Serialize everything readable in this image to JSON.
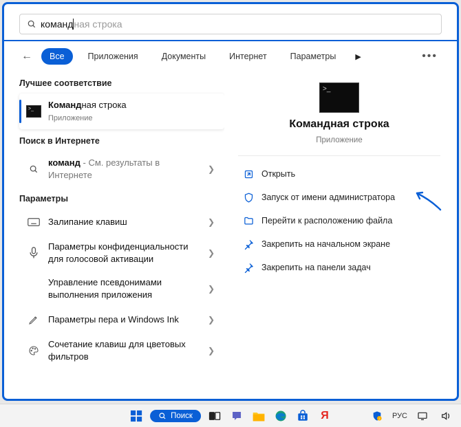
{
  "search": {
    "typed": "команд",
    "suggestion_tail": "ная строка"
  },
  "tabs": {
    "items": [
      "Все",
      "Приложения",
      "Документы",
      "Интернет",
      "Параметры"
    ],
    "active_index": 0
  },
  "left": {
    "best_match_header": "Лучшее соответствие",
    "best_match": {
      "title_bold": "Команд",
      "title_rest": "ная строка",
      "subtitle": "Приложение"
    },
    "web_header": "Поиск в Интернете",
    "web_item": {
      "title_bold": "команд",
      "title_rest": " - См. результаты в Интернете"
    },
    "settings_header": "Параметры",
    "settings_items": [
      {
        "label": "Залипание клавиш",
        "icon": "keyboard-icon"
      },
      {
        "label": "Параметры конфиденциальности для голосовой активации",
        "icon": "mic-icon"
      },
      {
        "label": "Управление псевдонимами выполнения приложения",
        "icon": "blank-icon"
      },
      {
        "label": "Параметры пера и Windows Ink",
        "icon": "pen-icon"
      },
      {
        "label": "Сочетание клавиш для цветовых фильтров",
        "icon": "palette-icon"
      }
    ]
  },
  "preview": {
    "title": "Командная строка",
    "subtitle": "Приложение",
    "actions": [
      {
        "label": "Открыть",
        "icon": "open-icon"
      },
      {
        "label": "Запуск от имени администратора",
        "icon": "admin-icon"
      },
      {
        "label": "Перейти к расположению файла",
        "icon": "folder-icon"
      },
      {
        "label": "Закрепить на начальном экране",
        "icon": "pin-icon"
      },
      {
        "label": "Закрепить на панели задач",
        "icon": "pin-icon"
      }
    ]
  },
  "taskbar": {
    "search_label": "Поиск",
    "lang": "РУС"
  }
}
